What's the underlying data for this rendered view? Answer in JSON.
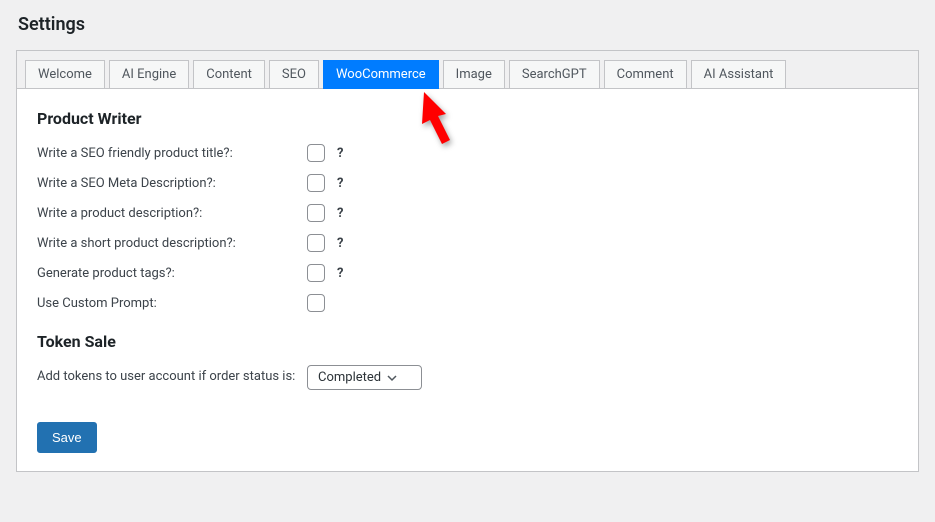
{
  "pageTitle": "Settings",
  "tabs": [
    {
      "id": "welcome",
      "label": "Welcome",
      "active": false
    },
    {
      "id": "ai-engine",
      "label": "AI Engine",
      "active": false
    },
    {
      "id": "content",
      "label": "Content",
      "active": false
    },
    {
      "id": "seo",
      "label": "SEO",
      "active": false
    },
    {
      "id": "woocommerce",
      "label": "WooCommerce",
      "active": true
    },
    {
      "id": "image",
      "label": "Image",
      "active": false
    },
    {
      "id": "searchgpt",
      "label": "SearchGPT",
      "active": false
    },
    {
      "id": "comment",
      "label": "Comment",
      "active": false
    },
    {
      "id": "ai-assistant",
      "label": "AI Assistant",
      "active": false
    }
  ],
  "sections": {
    "productWriter": {
      "title": "Product Writer",
      "rows": [
        {
          "label": "Write a SEO friendly product title?:",
          "checked": false,
          "help": "?"
        },
        {
          "label": "Write a SEO Meta Description?:",
          "checked": false,
          "help": "?"
        },
        {
          "label": "Write a product description?:",
          "checked": false,
          "help": "?"
        },
        {
          "label": "Write a short product description?:",
          "checked": false,
          "help": "?"
        },
        {
          "label": "Generate product tags?:",
          "checked": false,
          "help": "?"
        },
        {
          "label": "Use Custom Prompt:",
          "checked": false,
          "help": ""
        }
      ]
    },
    "tokenSale": {
      "title": "Token Sale",
      "label": "Add tokens to user account if order status is:",
      "selectValue": "Completed"
    }
  },
  "buttons": {
    "save": "Save"
  },
  "colors": {
    "tabActive": "#007cff",
    "save": "#2271b1",
    "arrow": "#ff0000"
  }
}
